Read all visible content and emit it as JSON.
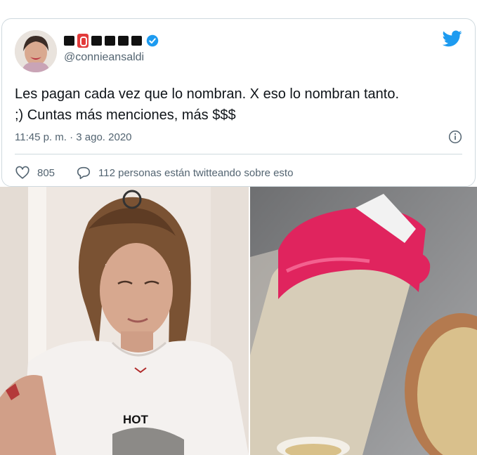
{
  "tweet": {
    "display_name_logo": "censored display name",
    "handle": "@connieansaldi",
    "text_line1": "Les pagan cada vez que lo nombran. X eso lo nombran tanto.",
    "text_line2": ";) Cuntas más menciones, más $$$",
    "timestamp": "11:45 p. m. · 3 ago. 2020",
    "likes": "805",
    "talking": "112 personas están twitteando sobre esto"
  },
  "images": {
    "left_shirt_text": "HOT"
  },
  "colors": {
    "twitter_blue": "#1d9bf0",
    "muted_text": "#536471",
    "border": "#cfd9de",
    "shaker_pink": "#e0245e"
  },
  "icons": [
    "twitter-bird-icon",
    "verified-badge-icon",
    "info-icon",
    "heart-icon",
    "reply-icon"
  ]
}
